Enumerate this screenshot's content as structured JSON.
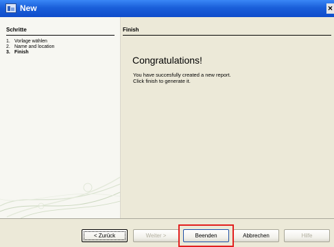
{
  "window": {
    "title": "New",
    "close_glyph": "×"
  },
  "steps_panel": {
    "header": "Schritte",
    "items": [
      {
        "number": "1.",
        "label": "Vorlage wählen"
      },
      {
        "number": "2.",
        "label": "Name and location"
      },
      {
        "number": "3.",
        "label": "Finish"
      }
    ]
  },
  "content": {
    "header": "Finish",
    "heading": "Congratulations!",
    "lines": [
      "You have succesfully created a new report.",
      "Click finish to generate it."
    ]
  },
  "buttons": {
    "back": "< Zurück",
    "next": "Weiter >",
    "finish": "Beenden",
    "cancel": "Abbrechen",
    "help": "Hilfe"
  },
  "colors": {
    "titlebar": "#1a5fd9",
    "highlight": "#e21d1d",
    "panel": "#ece9d8"
  }
}
